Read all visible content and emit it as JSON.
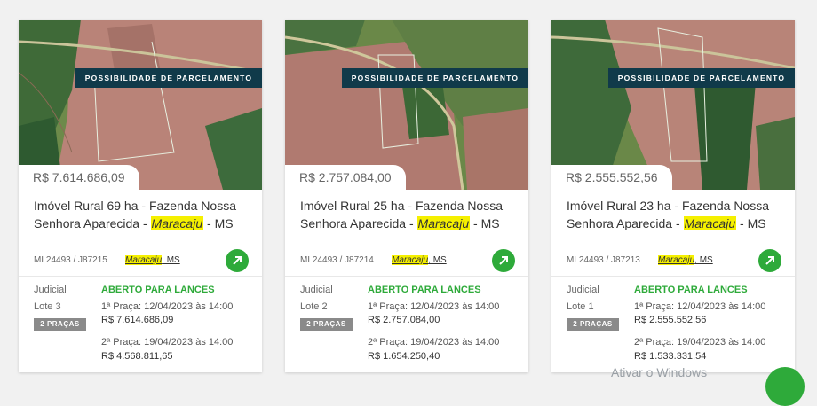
{
  "cards": [
    {
      "banner": "POSSIBILIDADE DE PARCELAMENTO",
      "price": "R$ 7.614.686,09",
      "title_pre": "Imóvel Rural 69 ha - Fazenda Nossa Senhora Aparecida - ",
      "title_city": "Maracaju",
      "title_post": " - MS",
      "code": "ML24493 / J87215",
      "city": "Maracaju",
      "state": ", MS",
      "type": "Judicial",
      "lote": "Lote 3",
      "pracas": "2 PRAÇAS",
      "status": "ABERTO PARA LANCES",
      "praca1_date": "1ª Praça: 12/04/2023 às 14:00",
      "praca1_value": "R$ 7.614.686,09",
      "praca2_date": "2ª Praça: 19/04/2023 às 14:00",
      "praca2_value": "R$ 4.568.811,65"
    },
    {
      "banner": "POSSIBILIDADE DE PARCELAMENTO",
      "price": "R$ 2.757.084,00",
      "title_pre": "Imóvel Rural 25 ha - Fazenda Nossa Senhora Aparecida - ",
      "title_city": "Maracaju",
      "title_post": " - MS",
      "code": "ML24493 / J87214",
      "city": "Maracaju",
      "state": ", MS",
      "type": "Judicial",
      "lote": "Lote 2",
      "pracas": "2 PRAÇAS",
      "status": "ABERTO PARA LANCES",
      "praca1_date": "1ª Praça: 12/04/2023 às 14:00",
      "praca1_value": "R$ 2.757.084,00",
      "praca2_date": "2ª Praça: 19/04/2023 às 14:00",
      "praca2_value": "R$ 1.654.250,40"
    },
    {
      "banner": "POSSIBILIDADE DE PARCELAMENTO",
      "price": "R$ 2.555.552,56",
      "title_pre": "Imóvel Rural 23 ha - Fazenda Nossa Senhora Aparecida - ",
      "title_city": "Maracaju",
      "title_post": " - MS",
      "code": "ML24493 / J87213",
      "city": "Maracaju",
      "state": ", MS",
      "type": "Judicial",
      "lote": "Lote 1",
      "pracas": "2 PRAÇAS",
      "status": "ABERTO PARA LANCES",
      "praca1_date": "1ª Praça: 12/04/2023 às 14:00",
      "praca1_value": "R$ 2.555.552,56",
      "praca2_date": "2ª Praça: 19/04/2023 às 14:00",
      "praca2_value": "R$ 1.533.331,54"
    }
  ],
  "watermark": "Ativar o Windows",
  "colors": {
    "accent_green": "#2eaa3a",
    "highlight": "#f5f000",
    "banner_bg": "#103a4a"
  },
  "icons": {
    "go": "arrow-up-right-icon",
    "chat": "chat-icon"
  }
}
